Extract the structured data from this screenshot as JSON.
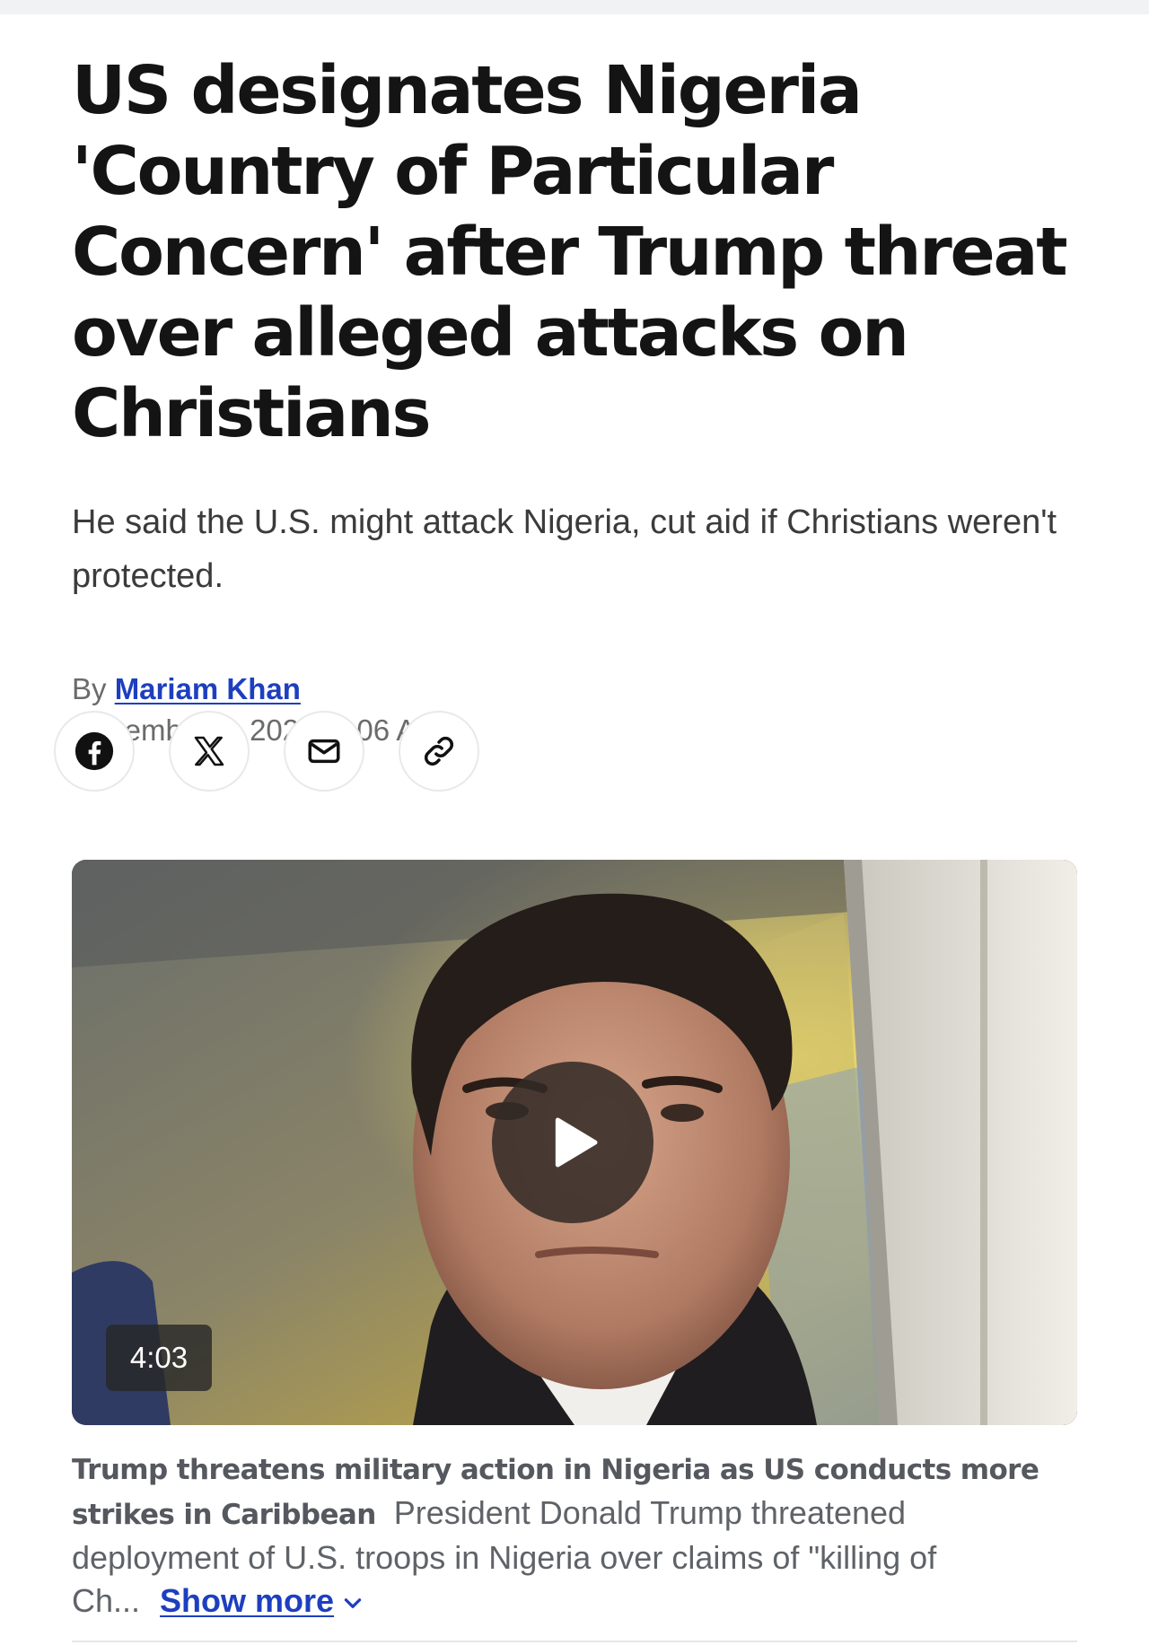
{
  "article": {
    "headline": "US designates Nigeria 'Country of Particular Concern' after Trump threat over alleged attacks on Christians",
    "subhead": "He said the U.S. might attack Nigeria, cut aid if Christians weren't protected.",
    "byline_prefix": "By",
    "author": "Mariam Khan",
    "date": "November 4, 2025, 7:06 AM"
  },
  "share": [
    {
      "icon": "facebook-icon"
    },
    {
      "icon": "x-icon"
    },
    {
      "icon": "email-icon"
    },
    {
      "icon": "link-icon"
    }
  ],
  "video": {
    "duration": "4:03",
    "caption_title": "Trump threatens military action in Nigeria as US conducts more strikes in Caribbean",
    "caption_text": "President Donald Trump threatened deployment of U.S. troops in Nigeria over claims of \"killing of Ch...",
    "show_more_label": "Show more"
  },
  "colors": {
    "link": "#1d3fbf",
    "headline": "#141414",
    "muted": "#6b6b6b"
  }
}
